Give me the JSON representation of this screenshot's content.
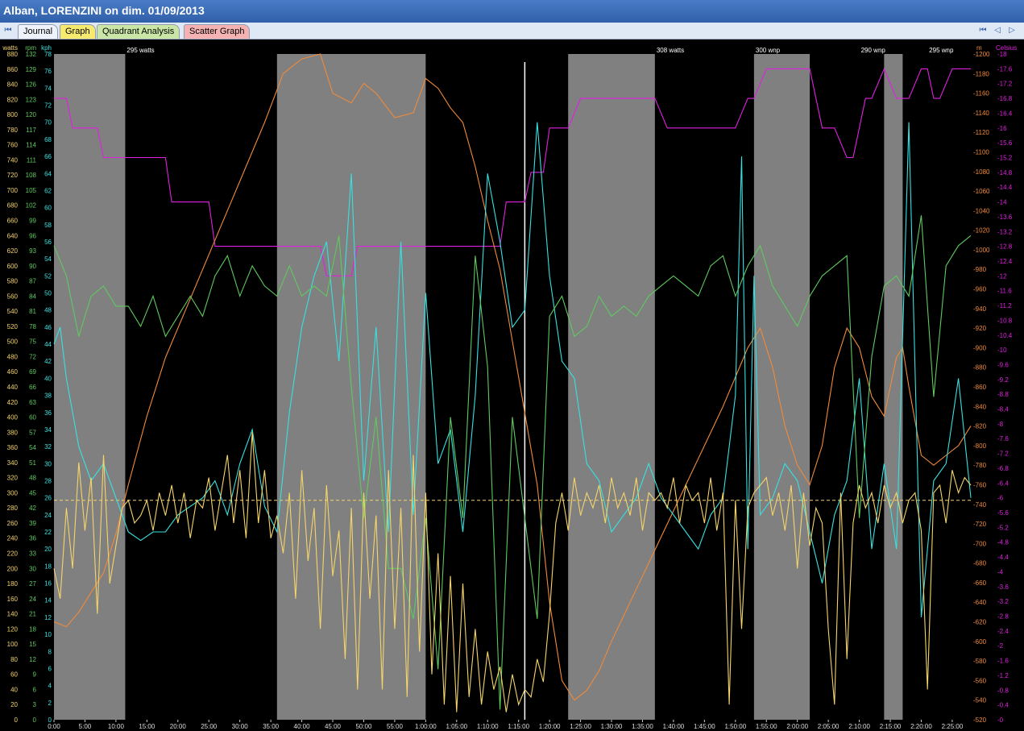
{
  "window": {
    "title": "Alban, LORENZINI on dim. 01/09/2013"
  },
  "tabs": [
    {
      "label": "Journal"
    },
    {
      "label": "Graph"
    },
    {
      "label": "Quadrant Analysis"
    },
    {
      "label": "Scatter Graph"
    }
  ],
  "nav": {
    "first": "⏮",
    "prev": "◁",
    "next": "▷",
    "last": "⏭"
  },
  "colors": {
    "power": "#f5d46a",
    "cadence": "#5fc95f",
    "speed": "#38e0e0",
    "altitude": "#f08a3a",
    "temperature": "#e020e0",
    "interval_bg": "#808080",
    "rest_bg": "#000000",
    "cursor": "#ffffff"
  },
  "chart_data": {
    "type": "line",
    "x_unit": "elapsed time (h:mm)",
    "xlim": [
      0,
      148
    ],
    "x_ticks": [
      "0:00",
      "5:00",
      "10:00",
      "15:00",
      "20:00",
      "25:00",
      "30:00",
      "35:00",
      "40:00",
      "45:00",
      "50:00",
      "55:00",
      "1:00:00",
      "1:05:00",
      "1:10:00",
      "1:15:00",
      "1:20:00",
      "1:25:00",
      "1:30:00",
      "1:35:00",
      "1:40:00",
      "1:45:00",
      "1:50:00",
      "1:55:00",
      "2:00:00",
      "2:05:00",
      "2:10:00",
      "2:15:00",
      "2:20:00",
      "2:25:00"
    ],
    "axes": {
      "watts": {
        "label": "watts",
        "ylim": [
          0,
          880
        ],
        "step": 20
      },
      "rpm": {
        "label": "rpm",
        "ylim": [
          0,
          132
        ],
        "step": 3
      },
      "kph": {
        "label": "kph",
        "ylim": [
          0,
          78
        ],
        "step": 2
      },
      "m": {
        "label": "m",
        "ylim": [
          520,
          1200
        ],
        "step": 20
      },
      "celsius": {
        "label": "Celsius",
        "ylim": [
          0,
          -18
        ],
        "step": -0.4
      }
    },
    "interval_shading": [
      [
        0,
        11.5
      ],
      [
        36,
        60
      ],
      [
        83,
        97
      ],
      [
        113,
        122
      ],
      [
        134,
        137
      ]
    ],
    "interval_labels": [
      {
        "x": 11.5,
        "text": "295 watts"
      },
      {
        "x": 97,
        "text": "308 watts"
      },
      {
        "x": 113,
        "text": "300 wnp"
      },
      {
        "x": 130,
        "text": "290 wnp"
      },
      {
        "x": 141,
        "text": "295 wnp"
      }
    ],
    "cursor_x": 76,
    "reference_line": {
      "axis": "watts",
      "value": 290
    },
    "series": [
      {
        "name": "temperature",
        "axis": "celsius",
        "x": [
          0,
          2,
          3,
          7,
          8,
          18,
          19,
          25,
          26,
          43,
          44,
          48,
          49,
          72,
          73,
          76,
          77,
          79,
          80,
          83,
          85,
          97,
          99,
          110,
          112,
          113,
          115,
          122,
          123,
          124,
          126,
          128,
          129,
          130,
          131,
          132,
          134,
          136,
          137,
          138,
          140,
          141,
          142,
          143,
          145,
          148
        ],
        "y": [
          -16.8,
          -16.8,
          -16,
          -16,
          -15.2,
          -15.2,
          -14,
          -14,
          -12.8,
          -12.8,
          -12,
          -12,
          -12.8,
          -12.8,
          -14,
          -14,
          -14.8,
          -14.8,
          -16,
          -16,
          -16.8,
          -16.8,
          -16,
          -16,
          -16.8,
          -16.8,
          -17.6,
          -17.6,
          -16.8,
          -16,
          -16,
          -15.2,
          -15.2,
          -16,
          -16.8,
          -16.8,
          -17.6,
          -16.8,
          -16.8,
          -16.8,
          -17.6,
          -17.6,
          -16.8,
          -16.8,
          -17.6,
          -17.6
        ]
      },
      {
        "name": "altitude",
        "axis": "m",
        "x": [
          0,
          2,
          4,
          6,
          8,
          10,
          12,
          15,
          18,
          22,
          26,
          30,
          34,
          37,
          40,
          43,
          45,
          48,
          50,
          52,
          55,
          58,
          60,
          62,
          64,
          66,
          68,
          70,
          72,
          75,
          78,
          80,
          82,
          84,
          86,
          88,
          90,
          93,
          96,
          99,
          102,
          105,
          108,
          110,
          112,
          114,
          116,
          118,
          120,
          122,
          124,
          126,
          128,
          130,
          132,
          134,
          135,
          136,
          137,
          138,
          140,
          142,
          144,
          146,
          148
        ],
        "y": [
          620,
          615,
          630,
          650,
          670,
          710,
          760,
          830,
          890,
          950,
          1010,
          1070,
          1130,
          1180,
          1195,
          1200,
          1160,
          1150,
          1170,
          1160,
          1135,
          1140,
          1175,
          1165,
          1145,
          1130,
          1085,
          1030,
          980,
          870,
          760,
          640,
          560,
          540,
          550,
          570,
          600,
          640,
          680,
          720,
          760,
          800,
          840,
          870,
          900,
          920,
          880,
          820,
          780,
          760,
          800,
          880,
          920,
          900,
          850,
          830,
          860,
          890,
          900,
          860,
          790,
          780,
          790,
          800,
          820
        ]
      },
      {
        "name": "speed",
        "axis": "kph",
        "x": [
          0,
          1,
          2,
          3,
          4,
          5,
          6,
          8,
          10,
          12,
          14,
          16,
          18,
          20,
          22,
          24,
          26,
          28,
          30,
          32,
          34,
          36,
          38,
          40,
          42,
          44,
          46,
          48,
          50,
          52,
          54,
          56,
          58,
          60,
          62,
          64,
          66,
          68,
          70,
          72,
          74,
          76,
          78,
          80,
          82,
          84,
          86,
          88,
          90,
          92,
          94,
          96,
          98,
          100,
          102,
          104,
          106,
          108,
          110,
          111,
          112,
          113,
          114,
          116,
          118,
          120,
          122,
          124,
          126,
          128,
          130,
          132,
          134,
          136,
          138,
          140,
          142,
          144,
          146,
          148
        ],
        "y": [
          44,
          46,
          40,
          36,
          32,
          30,
          28,
          30,
          26,
          22,
          21,
          22,
          22,
          24,
          25,
          26,
          28,
          24,
          30,
          34,
          25,
          22,
          36,
          46,
          52,
          56,
          42,
          64,
          28,
          46,
          22,
          56,
          24,
          50,
          30,
          34,
          22,
          38,
          64,
          56,
          46,
          48,
          70,
          52,
          42,
          40,
          30,
          28,
          22,
          24,
          26,
          30,
          26,
          24,
          22,
          20,
          24,
          26,
          38,
          66,
          20,
          52,
          24,
          26,
          30,
          28,
          22,
          16,
          24,
          28,
          40,
          20,
          30,
          20,
          70,
          12,
          28,
          30,
          40,
          26
        ]
      },
      {
        "name": "cadence",
        "axis": "rpm",
        "x": [
          0,
          2,
          4,
          6,
          8,
          10,
          12,
          14,
          16,
          18,
          20,
          22,
          24,
          26,
          28,
          30,
          32,
          34,
          36,
          38,
          40,
          42,
          44,
          46,
          48,
          50,
          52,
          54,
          56,
          58,
          60,
          62,
          64,
          66,
          68,
          70,
          72,
          74,
          76,
          78,
          80,
          82,
          84,
          86,
          88,
          90,
          92,
          94,
          96,
          98,
          100,
          102,
          104,
          106,
          108,
          110,
          112,
          114,
          116,
          118,
          120,
          122,
          124,
          126,
          128,
          130,
          132,
          134,
          136,
          138,
          140,
          142,
          144,
          146,
          148
        ],
        "y": [
          94,
          88,
          76,
          84,
          86,
          82,
          82,
          78,
          84,
          76,
          80,
          84,
          80,
          88,
          92,
          84,
          90,
          86,
          84,
          90,
          84,
          86,
          84,
          96,
          66,
          40,
          60,
          30,
          30,
          20,
          40,
          10,
          60,
          40,
          92,
          70,
          2,
          60,
          40,
          20,
          80,
          84,
          76,
          78,
          84,
          80,
          82,
          80,
          84,
          86,
          88,
          86,
          84,
          90,
          92,
          84,
          90,
          94,
          86,
          82,
          78,
          84,
          88,
          90,
          92,
          40,
          72,
          86,
          88,
          84,
          100,
          64,
          90,
          94,
          96
        ]
      },
      {
        "name": "power",
        "axis": "watts",
        "x": [
          0,
          1,
          2,
          3,
          4,
          5,
          6,
          7,
          8,
          9,
          10,
          11,
          12,
          13,
          14,
          15,
          16,
          17,
          18,
          19,
          20,
          21,
          22,
          23,
          24,
          25,
          26,
          27,
          28,
          29,
          30,
          31,
          32,
          33,
          34,
          35,
          36,
          37,
          38,
          39,
          40,
          41,
          42,
          43,
          44,
          45,
          46,
          47,
          48,
          49,
          50,
          51,
          52,
          53,
          54,
          55,
          56,
          57,
          58,
          59,
          60,
          61,
          62,
          63,
          64,
          65,
          66,
          67,
          68,
          69,
          70,
          71,
          72,
          73,
          74,
          75,
          76,
          77,
          78,
          79,
          80,
          81,
          82,
          83,
          84,
          85,
          86,
          87,
          88,
          89,
          90,
          91,
          92,
          93,
          94,
          95,
          96,
          97,
          98,
          99,
          100,
          101,
          102,
          103,
          104,
          105,
          106,
          107,
          108,
          109,
          110,
          111,
          112,
          113,
          114,
          115,
          116,
          117,
          118,
          119,
          120,
          121,
          122,
          123,
          124,
          125,
          126,
          127,
          128,
          129,
          130,
          131,
          132,
          133,
          134,
          135,
          136,
          137,
          138,
          139,
          140,
          141,
          142,
          143,
          144,
          145,
          146,
          147,
          148
        ],
        "y": [
          200,
          160,
          280,
          200,
          340,
          250,
          320,
          140,
          350,
          180,
          230,
          280,
          290,
          260,
          270,
          290,
          250,
          300,
          270,
          310,
          260,
          300,
          240,
          290,
          280,
          320,
          250,
          300,
          350,
          260,
          330,
          240,
          380,
          260,
          330,
          240,
          270,
          220,
          300,
          160,
          330,
          210,
          280,
          120,
          310,
          190,
          250,
          80,
          280,
          40,
          300,
          160,
          270,
          40,
          330,
          120,
          280,
          30,
          350,
          90,
          300,
          60,
          220,
          20,
          190,
          10,
          180,
          30,
          120,
          20,
          90,
          40,
          70,
          10,
          60,
          20,
          40,
          30,
          80,
          50,
          140,
          260,
          300,
          250,
          320,
          270,
          300,
          280,
          310,
          260,
          320,
          280,
          300,
          270,
          320,
          250,
          300,
          290,
          300,
          280,
          320,
          260,
          310,
          290,
          300,
          260,
          320,
          250,
          300,
          20,
          290,
          120,
          280,
          300,
          310,
          320,
          270,
          300,
          250,
          310,
          200,
          300,
          230,
          280,
          260,
          120,
          20,
          300,
          80,
          260,
          310,
          280,
          300,
          260,
          310,
          280,
          300,
          260,
          290,
          300,
          250,
          40,
          300,
          310,
          260,
          330,
          300,
          320,
          310
        ]
      }
    ]
  }
}
